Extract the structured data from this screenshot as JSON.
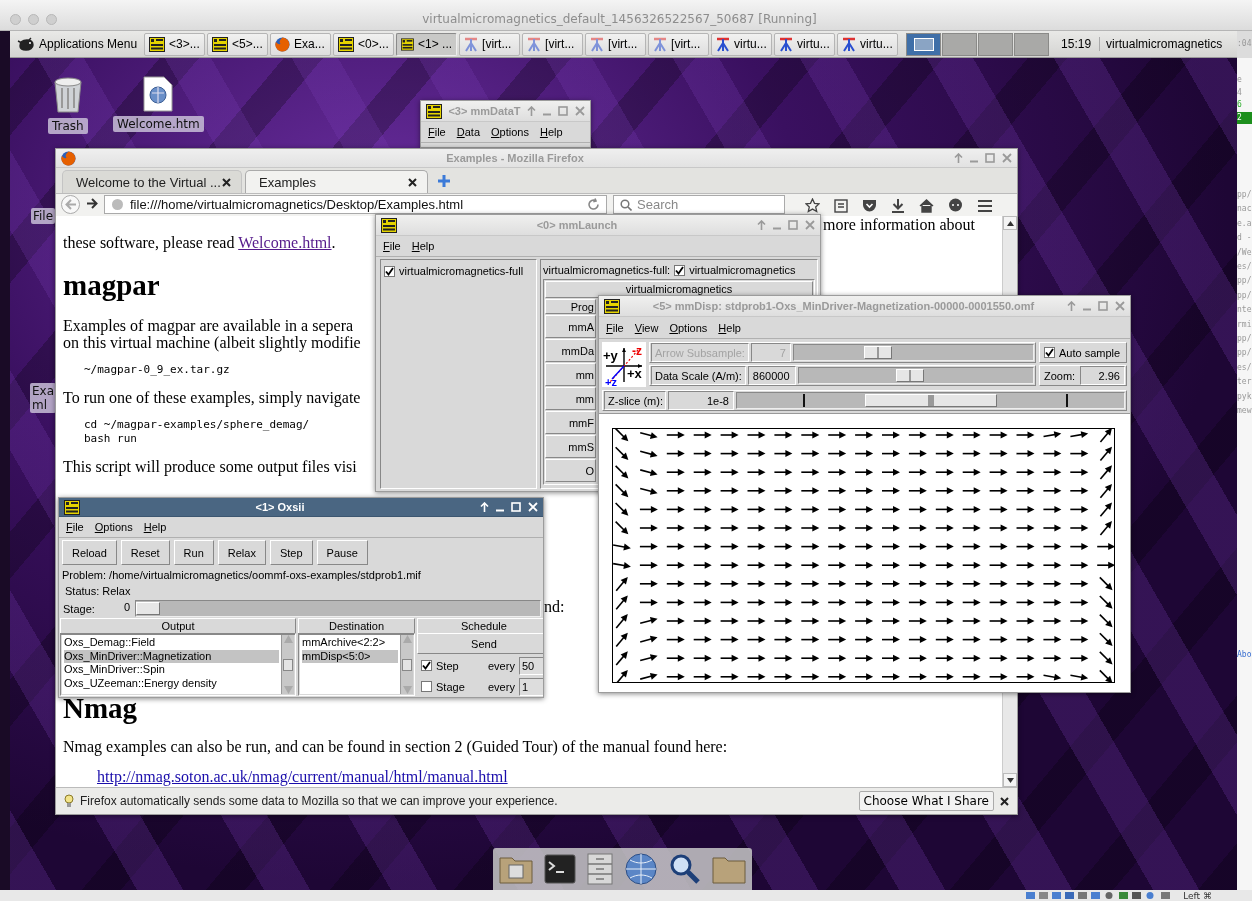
{
  "host_window": {
    "title": "virtualmicromagnetics_default_1456326522567_50687 [Running]"
  },
  "taskbar": {
    "menu_label": "Applications Menu",
    "tasks": [
      {
        "label": "<3>...",
        "kind": "mm",
        "selected": false
      },
      {
        "label": "<5>...",
        "kind": "mm",
        "selected": false
      },
      {
        "label": "Exa...",
        "kind": "firefox",
        "selected": false
      },
      {
        "label": "<0>...",
        "kind": "mm",
        "selected": false
      },
      {
        "label": "<1> ...",
        "kind": "mm",
        "selected": true
      },
      {
        "label": "[virt...",
        "kind": "faded",
        "selected": false
      },
      {
        "label": "[virt...",
        "kind": "faded",
        "selected": false
      },
      {
        "label": "[virt...",
        "kind": "faded",
        "selected": false
      },
      {
        "label": "[virt...",
        "kind": "faded",
        "selected": false
      },
      {
        "label": "virtu...",
        "kind": "bold",
        "selected": false
      },
      {
        "label": "virtu...",
        "kind": "bold",
        "selected": false
      },
      {
        "label": "virtu...",
        "kind": "bold",
        "selected": false
      }
    ],
    "workspaces": [
      {
        "selected": true
      },
      {
        "selected": false
      },
      {
        "selected": false
      },
      {
        "selected": false
      }
    ],
    "clock": "15:19",
    "user": "virtualmicromagnetics"
  },
  "desktop_icons": [
    {
      "label": "Trash",
      "kind": "trash"
    },
    {
      "label": "Welcome.htm",
      "kind": "document"
    }
  ],
  "edge_labels": [
    "File",
    "Exa ml"
  ],
  "mm_data": {
    "title": "<3> mmDataT",
    "active": false,
    "menu": [
      "File",
      "Data",
      "Options",
      "Help"
    ]
  },
  "firefox": {
    "title": "Examples - Mozilla Firefox",
    "active": false,
    "tabs": [
      {
        "label": "Welcome to the Virtual ...",
        "selected": false
      },
      {
        "label": "Examples",
        "selected": true
      }
    ],
    "url": "file:///home/virtualmicromagnetics/Desktop/Examples.html",
    "search_placeholder": "Search",
    "content": [
      {
        "kind": "aside",
        "text": "more information about"
      },
      {
        "kind": "linkline",
        "before": "these software, please read ",
        "link": "Welcome.html",
        "after": "."
      },
      {
        "kind": "heading",
        "text": "magpar"
      },
      {
        "kind": "line",
        "text": "Examples of magpar are available in a sepera"
      },
      {
        "kind": "line",
        "text": "on this virtual machine (albeit slightly modifie"
      },
      {
        "kind": "code",
        "text": "~/magpar-0_9_ex.tar.gz"
      },
      {
        "kind": "line",
        "text": "To run one of these examples, simply navigate"
      },
      {
        "kind": "code",
        "text": "cd ~/magpar-examples/sphere_demag/"
      },
      {
        "kind": "code",
        "text": "bash run"
      },
      {
        "kind": "line",
        "text": "This script will produce some output files visi"
      },
      {
        "kind": "tail",
        "text": "nd:"
      },
      {
        "kind": "heading",
        "text": "Nmag"
      },
      {
        "kind": "line",
        "text": "Nmag examples can also be run, and can be found in section 2 (Guided Tour) of the manual found here:"
      },
      {
        "kind": "link",
        "text": "http://nmag.soton.ac.uk/nmag/current/manual/html/manual.html"
      }
    ],
    "notification": {
      "text": "Firefox automatically sends some data to Mozilla so that we can improve your experience.",
      "button": "Choose What I Share"
    }
  },
  "mm_launch": {
    "title": "<0> mmLaunch",
    "active": false,
    "menu": [
      "File",
      "Help"
    ],
    "hosts": [
      {
        "label": "virtualmicromagnetics-full",
        "checked": true
      }
    ],
    "account_label": "virtualmicromagnetics-full:",
    "accounts": [
      {
        "label": "virtualmicromagnetics",
        "checked": true
      }
    ],
    "panel_title": "virtualmicromagnetics",
    "programs_label": "Prog",
    "programs": [
      "mmA",
      "mmDa",
      "mm",
      "mm",
      "mmF",
      "mmS",
      "O"
    ]
  },
  "mm_disp": {
    "title": "<5> mmDisp: stdprob1-Oxs_MinDriver-Magnetization-00000-0001550.omf",
    "active": false,
    "menu": [
      "File",
      "View",
      "Options",
      "Help"
    ],
    "axes": [
      "+y",
      "-z",
      "+x",
      "+z"
    ],
    "controls": [
      {
        "label": "Arrow Subsample:",
        "value": "7",
        "level": 0.33,
        "disabled": true
      },
      {
        "label": "Data Scale (A/m):",
        "value": "860000",
        "level": 0.47,
        "disabled": false
      }
    ],
    "auto_sample": {
      "label": "Auto sample",
      "checked": true
    },
    "zoom": {
      "label": "Zoom:",
      "value": "2.96"
    },
    "z_slice": {
      "label": "Z-slice (m):",
      "value": "1e-8",
      "level": 0.5
    }
  },
  "oxsii": {
    "title": "<1> Oxsii",
    "active": true,
    "menu": [
      "File",
      "Options",
      "Help"
    ],
    "buttons": [
      "Reload",
      "Reset",
      "Run",
      "Relax",
      "Step",
      "Pause"
    ],
    "problem": "Problem: /home/virtualmicromagnetics/oommf-oxs-examples/stdprob1.mif",
    "status": "Status: Relax",
    "stage": {
      "label": "Stage:",
      "value": "0",
      "level": 0
    },
    "columns": [
      "Output",
      "Destination",
      "Schedule"
    ],
    "outputs": [
      {
        "label": "Oxs_Demag::Field",
        "selected": false
      },
      {
        "label": "Oxs_MinDriver::Magnetization",
        "selected": true
      },
      {
        "label": "Oxs_MinDriver::Spin",
        "selected": false
      },
      {
        "label": "Oxs_UZeeman::Energy density",
        "selected": false
      }
    ],
    "destinations": [
      {
        "label": "mmArchive<2:2>",
        "selected": false
      },
      {
        "label": "mmDisp<5:0>",
        "selected": true
      }
    ],
    "send": "Send",
    "schedule": [
      {
        "label": "Step",
        "checked": true,
        "every": "every",
        "value": "50"
      },
      {
        "label": "Stage",
        "checked": false,
        "every": "every",
        "value": "1"
      }
    ]
  },
  "terminal_strip": {
    "top": ":04",
    "lines": [
      {
        "text": "e",
        "kind": "plain"
      },
      {
        "text": "4",
        "kind": "plain"
      },
      {
        "text": "6",
        "kind": "green"
      },
      {
        "text": "2",
        "kind": "greenbg"
      }
    ],
    "more_lines": [
      "pp/",
      "nac",
      "e.a",
      "d -",
      "/We",
      "es/",
      "pp/",
      "pp/",
      "nte",
      "rmi",
      "pp/",
      "pp/",
      "es/",
      "ter",
      "pyk",
      "mew"
    ],
    "link": "Abo"
  },
  "tray": {
    "keyboard_hint": "Left ⌘"
  }
}
